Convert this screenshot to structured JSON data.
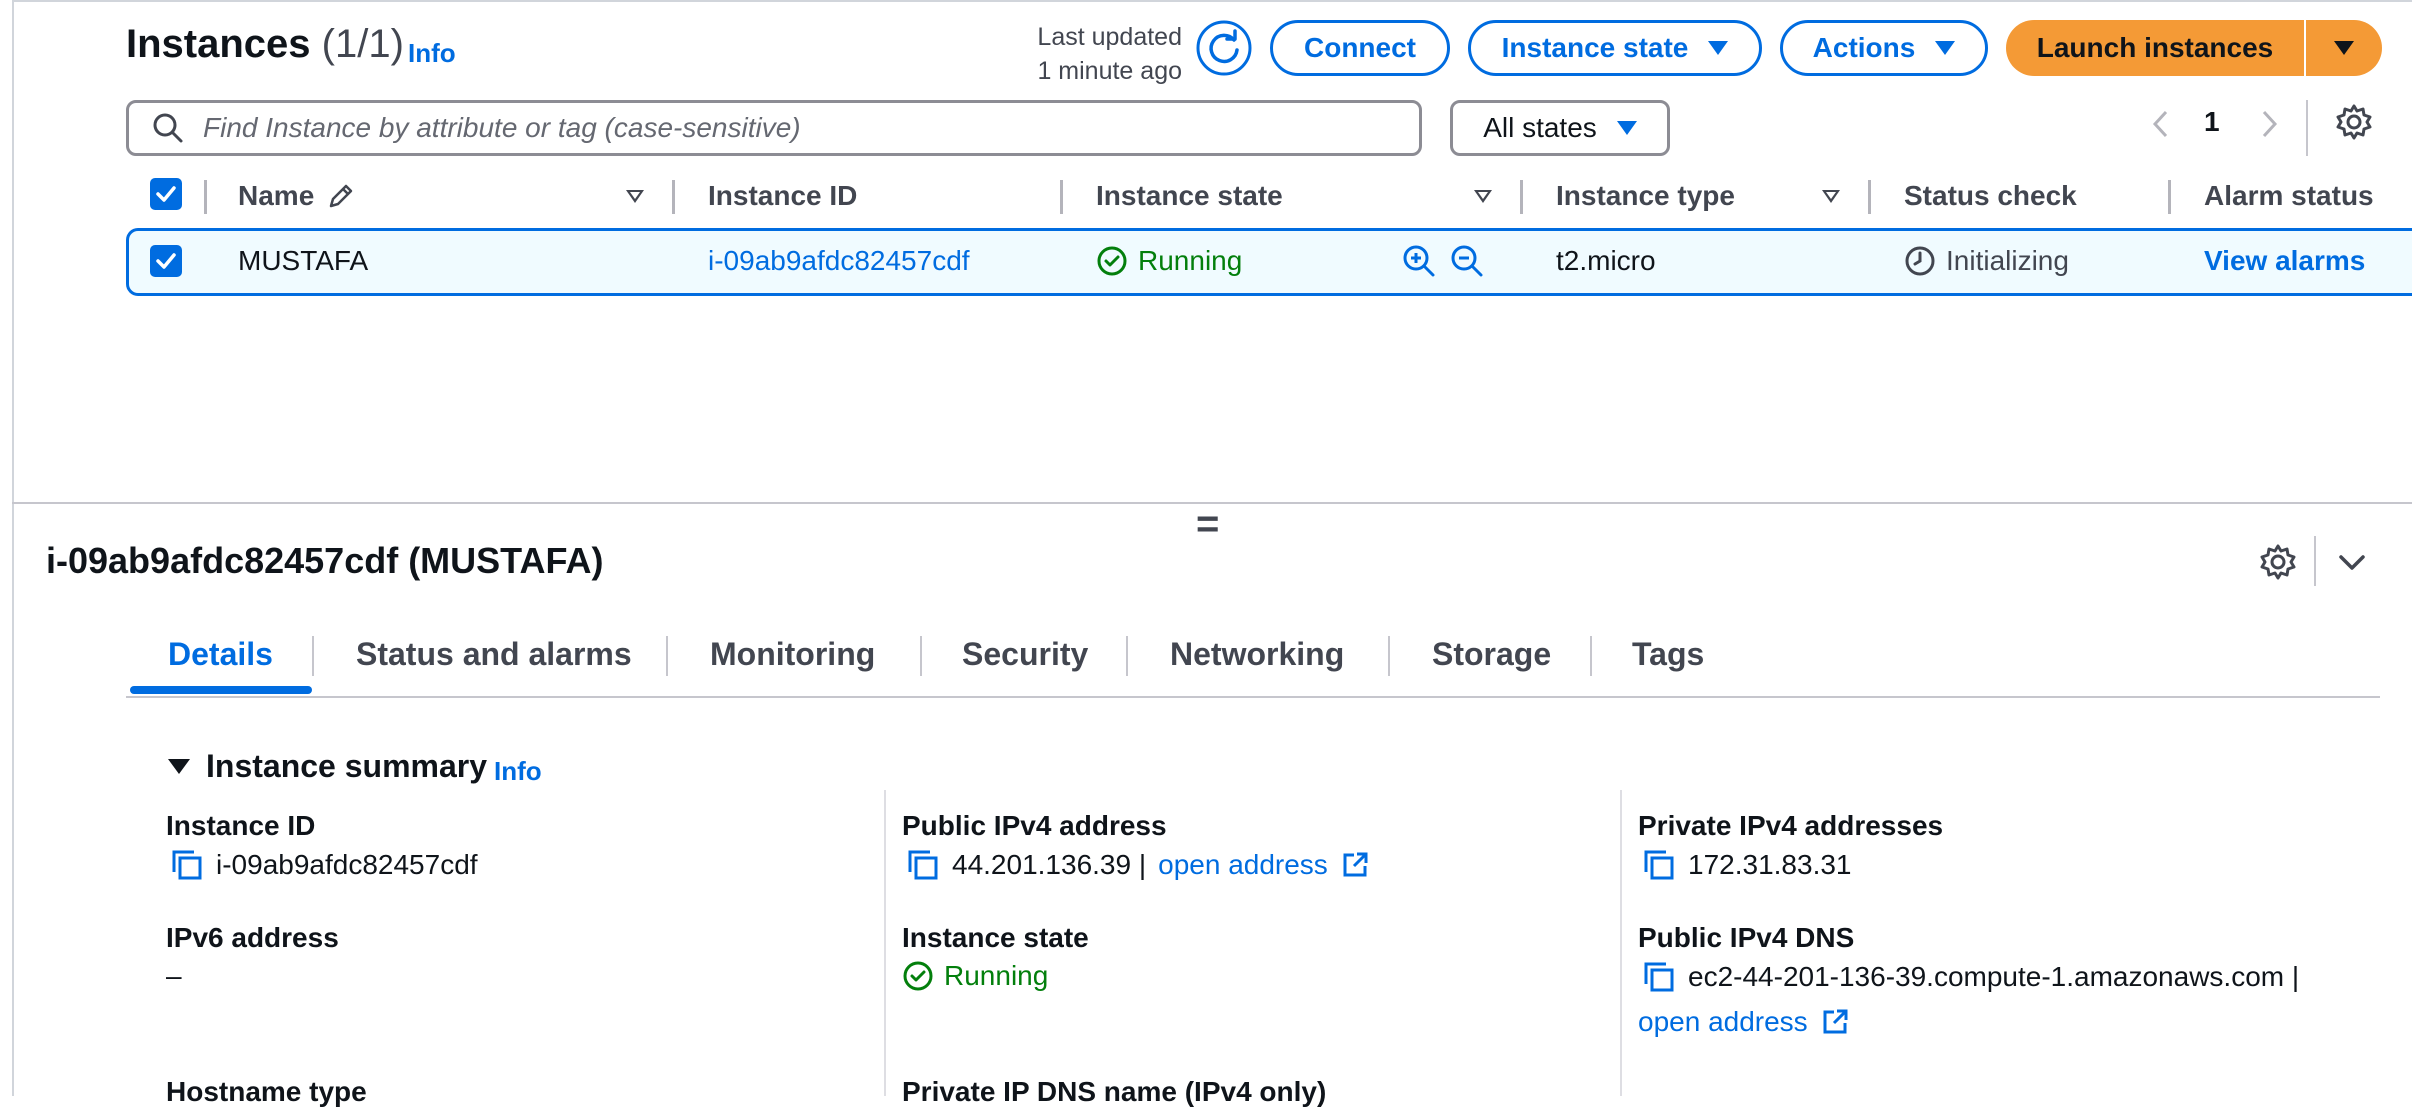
{
  "header": {
    "title": "Instances",
    "count": "(1/1)",
    "info_label": "Info",
    "last_updated_line1": "Last updated",
    "last_updated_line2": "1 minute ago",
    "connect_label": "Connect",
    "instance_state_label": "Instance state",
    "actions_label": "Actions",
    "launch_label": "Launch instances"
  },
  "search": {
    "placeholder": "Find Instance by attribute or tag (case-sensitive)",
    "state_filter": "All states"
  },
  "pagination": {
    "current_page": "1"
  },
  "table": {
    "columns": [
      "Name",
      "Instance ID",
      "Instance state",
      "Instance type",
      "Status check",
      "Alarm status"
    ],
    "rows": [
      {
        "name": "MUSTAFA",
        "instance_id": "i-09ab9afdc82457cdf",
        "state": "Running",
        "type": "t2.micro",
        "status_check": "Initializing",
        "alarm_status": "View alarms"
      }
    ]
  },
  "details": {
    "resize_handle": "=",
    "title": "i-09ab9afdc82457cdf (MUSTAFA)",
    "tabs": [
      "Details",
      "Status and alarms",
      "Monitoring",
      "Security",
      "Networking",
      "Storage",
      "Tags"
    ],
    "active_tab": "Details",
    "summary_title": "Instance summary",
    "summary_info": "Info",
    "fields": {
      "instance_id_label": "Instance ID",
      "instance_id_value": "i-09ab9afdc82457cdf",
      "public_ipv4_label": "Public IPv4 address",
      "public_ipv4_value": "44.201.136.39 |",
      "public_ipv4_link": "open address",
      "private_ipv4_label": "Private IPv4 addresses",
      "private_ipv4_value": "172.31.83.31",
      "ipv6_label": "IPv6 address",
      "ipv6_value": "–",
      "instance_state_label": "Instance state",
      "instance_state_value": "Running",
      "public_dns_label": "Public IPv4 DNS",
      "public_dns_value": "ec2-44-201-136-39.compute-1.amazonaws.com |",
      "public_dns_link": "open address",
      "hostname_label": "Hostname type",
      "private_dns_label": "Private IP DNS name (IPv4 only)"
    }
  },
  "colors": {
    "accent": "#006ce0",
    "launch": "#f49a36",
    "success": "#037f0c",
    "row_selected": "#f0fbff"
  },
  "icons": [
    "refresh-icon",
    "search-icon",
    "settings-icon",
    "edit-icon",
    "zoom-in-icon",
    "zoom-out-icon",
    "check-circle-icon",
    "clock-icon",
    "copy-icon",
    "external-link-icon",
    "chevron-down-icon",
    "caret-down-icon"
  ]
}
